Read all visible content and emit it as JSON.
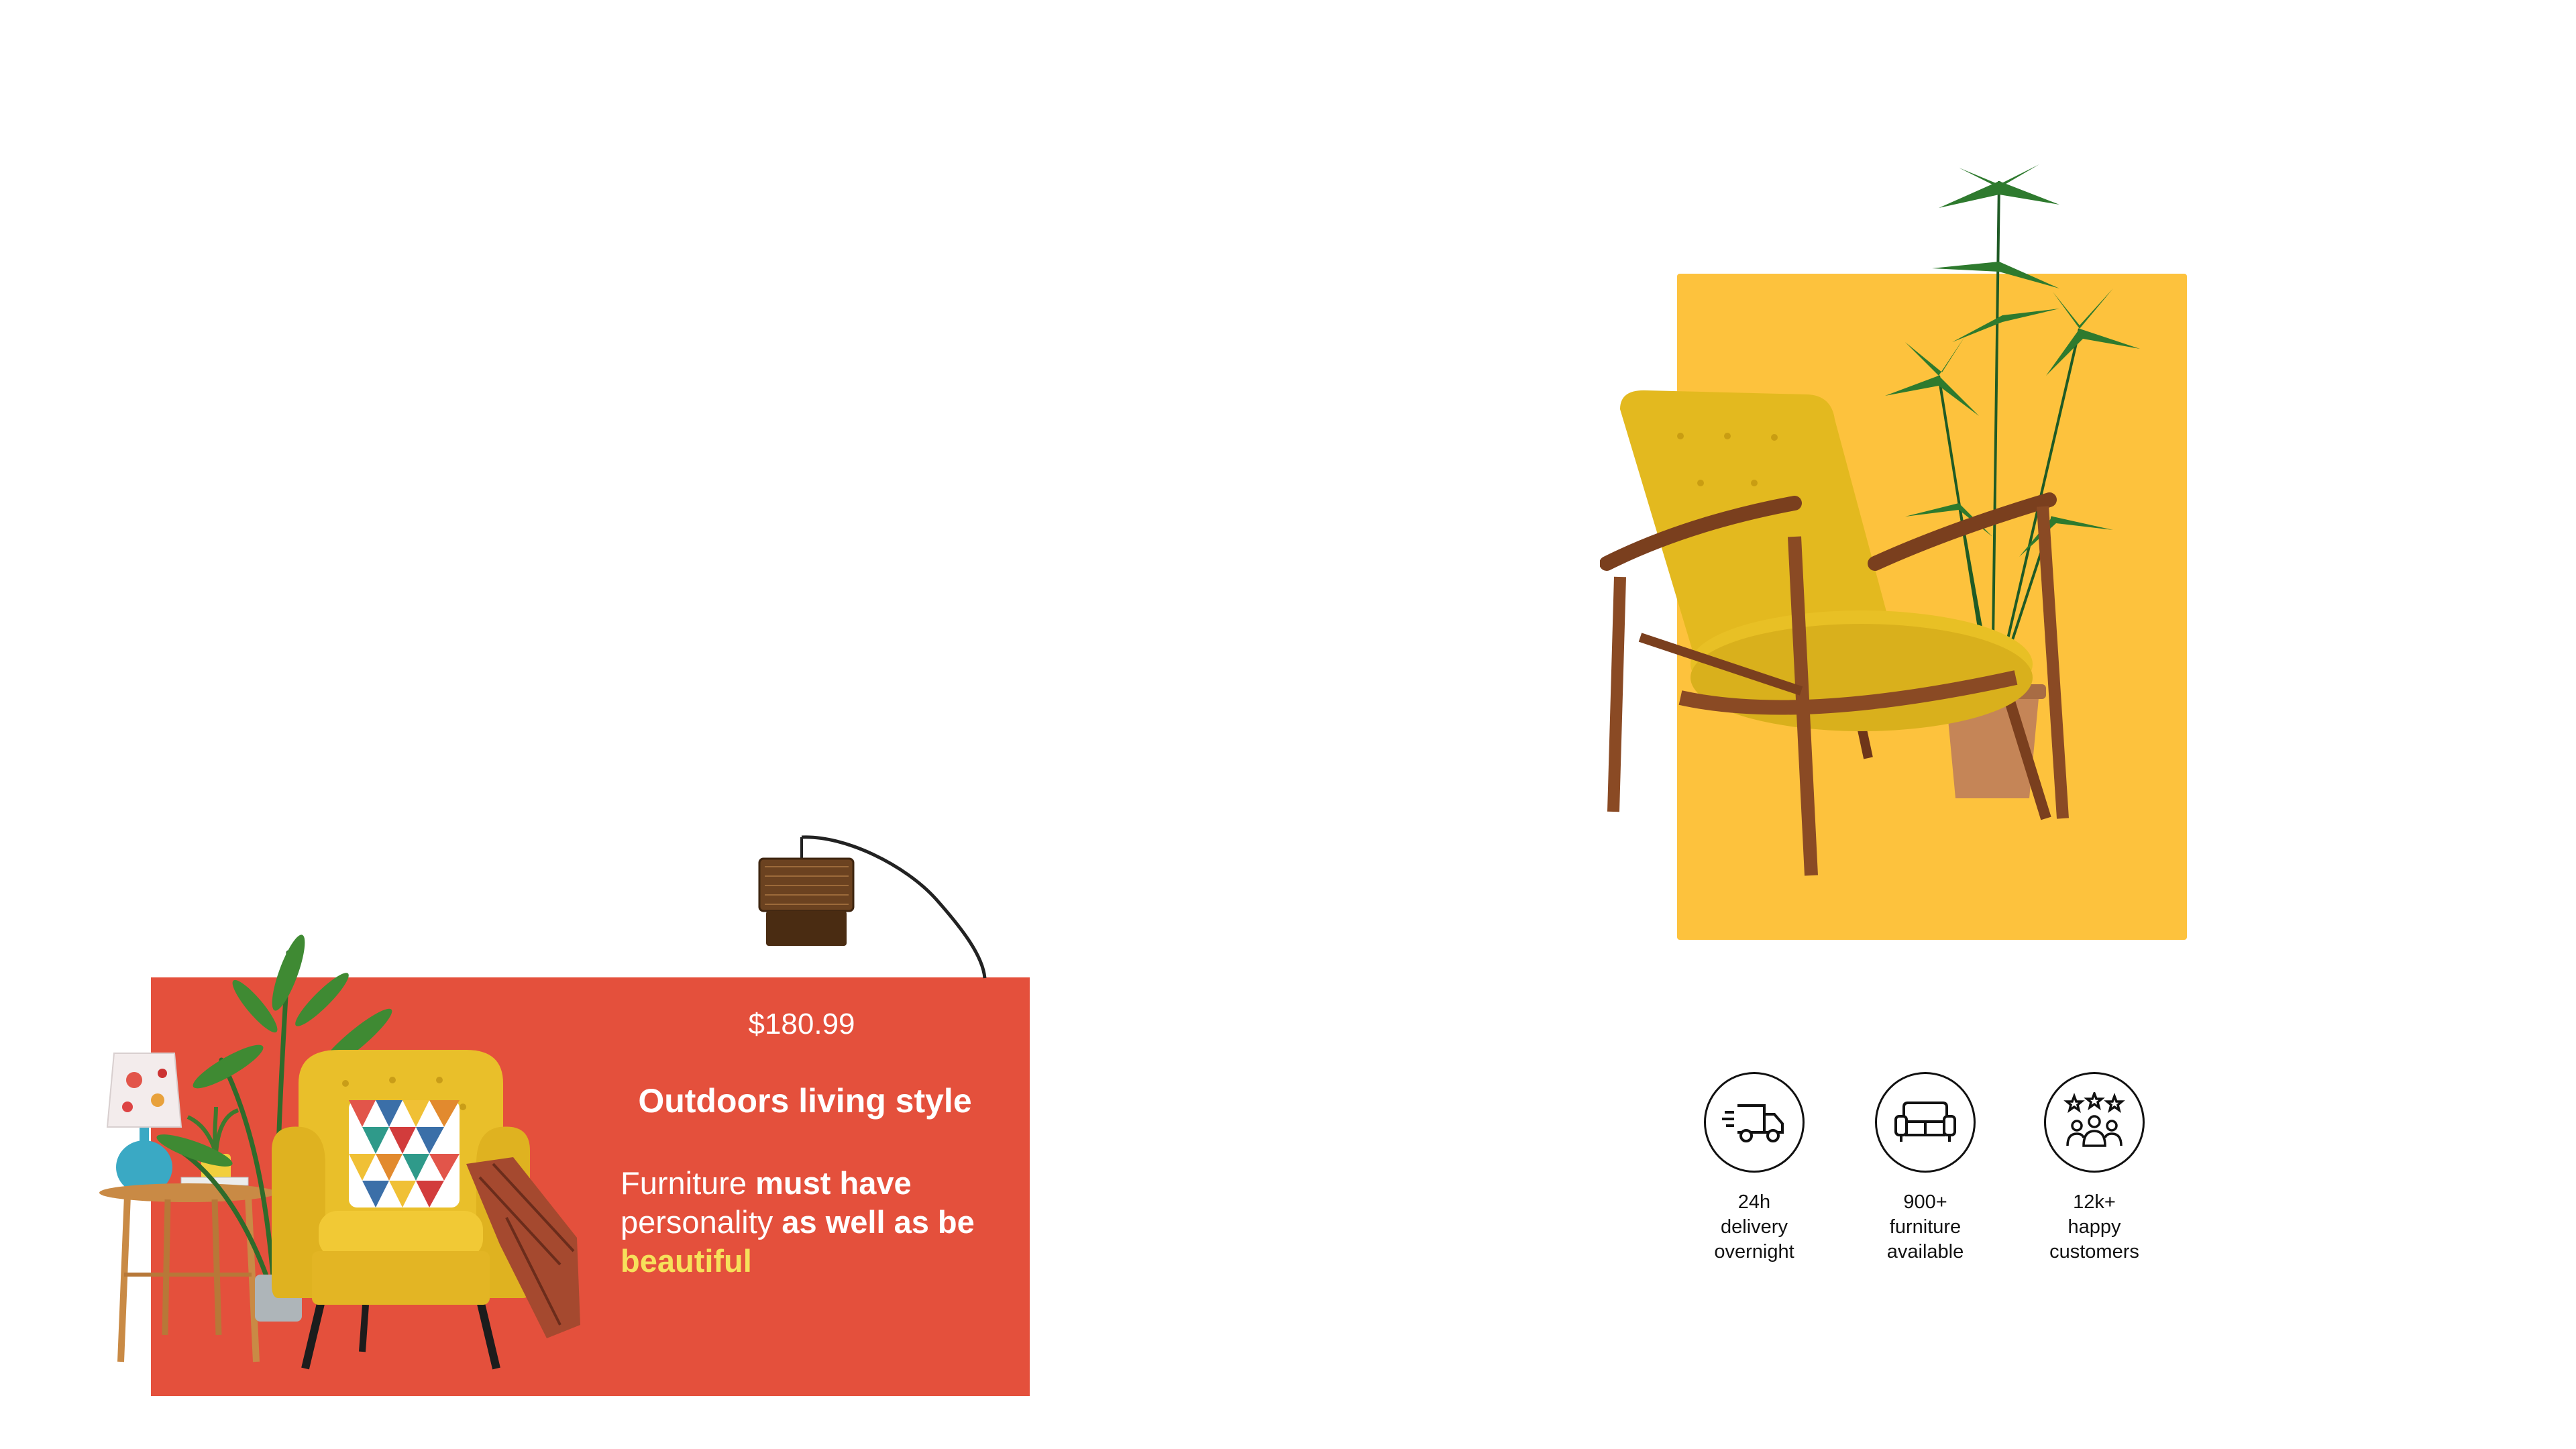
{
  "promo": {
    "price": "$180.99",
    "title": "Outdoors living style",
    "tagline_1": "Furniture ",
    "tagline_2": "must have",
    "tagline_3": "personality ",
    "tagline_4": "as well as be",
    "tagline_5": "beautiful"
  },
  "stats": [
    {
      "icon": "delivery-truck-icon",
      "label": "24h delivery overnight"
    },
    {
      "icon": "sofa-icon",
      "label": "900+ furniture available"
    },
    {
      "icon": "happy-customers-icon",
      "label": "12k+ happy customers"
    }
  ],
  "colors": {
    "promo_background": "#e4503c",
    "feature_background": "#fdc23d",
    "highlight": "#f6e15b",
    "chair_yellow": "#e9bf2a",
    "wood": "#8a4a24"
  }
}
